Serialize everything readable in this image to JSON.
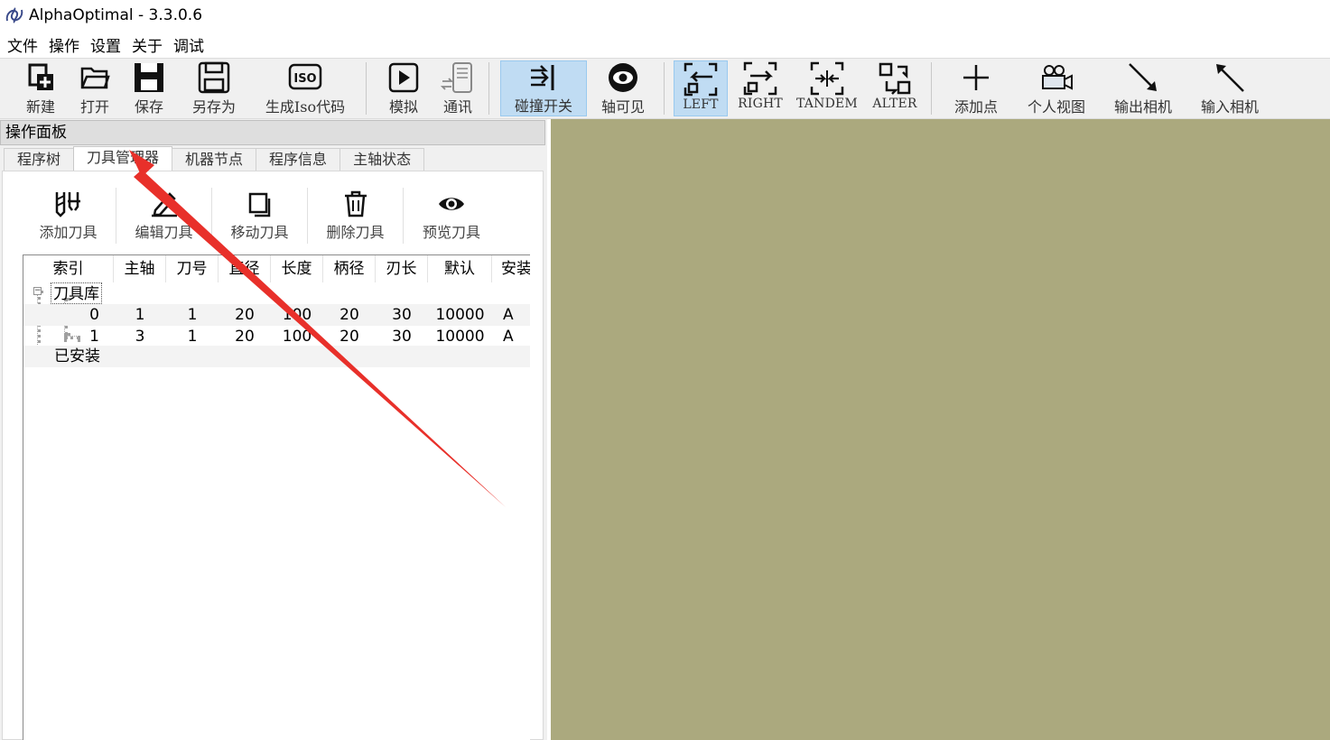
{
  "window": {
    "title": "AlphaOptimal  - 3.3.0.6"
  },
  "menu": [
    "文件",
    "操作",
    "设置",
    "关于",
    "调试"
  ],
  "toolbar": {
    "new": "新建",
    "open": "打开",
    "save": "保存",
    "save_as": "另存为",
    "gen_iso": "生成Iso代码",
    "simulate": "模拟",
    "comm": "通讯",
    "collision": "碰撞开关",
    "axis_visible": "轴可见",
    "left": "LEFT",
    "right": "RIGHT",
    "tandem": "TANDEM",
    "alter": "ALTER",
    "add_point": "添加点",
    "personal_view": "个人视图",
    "export_camera": "输出相机",
    "import_camera": "输入相机"
  },
  "panel": {
    "title": "操作面板",
    "tabs": [
      "程序树",
      "刀具管理器",
      "机器节点",
      "程序信息",
      "主轴状态"
    ],
    "active_tab": "刀具管理器",
    "tools": [
      "添加刀具",
      "编辑刀具",
      "移动刀具",
      "删除刀具",
      "预览刀具"
    ],
    "columns": [
      "索引",
      "主轴",
      "刀号",
      "直径",
      "长度",
      "柄径",
      "刃长",
      "默认",
      "安装"
    ],
    "tree": {
      "library_label": "刀具库",
      "installed_label": "已安装",
      "rows": [
        [
          "0",
          "1",
          "1",
          "20",
          "100",
          "20",
          "30",
          "10000",
          "A"
        ],
        [
          "1",
          "3",
          "1",
          "20",
          "100",
          "20",
          "30",
          "10000",
          "A"
        ]
      ]
    }
  },
  "colors": {
    "viewport": "#aba97e",
    "annotation_arrow": "#e8302a",
    "active_button": "#c0dcf3"
  }
}
